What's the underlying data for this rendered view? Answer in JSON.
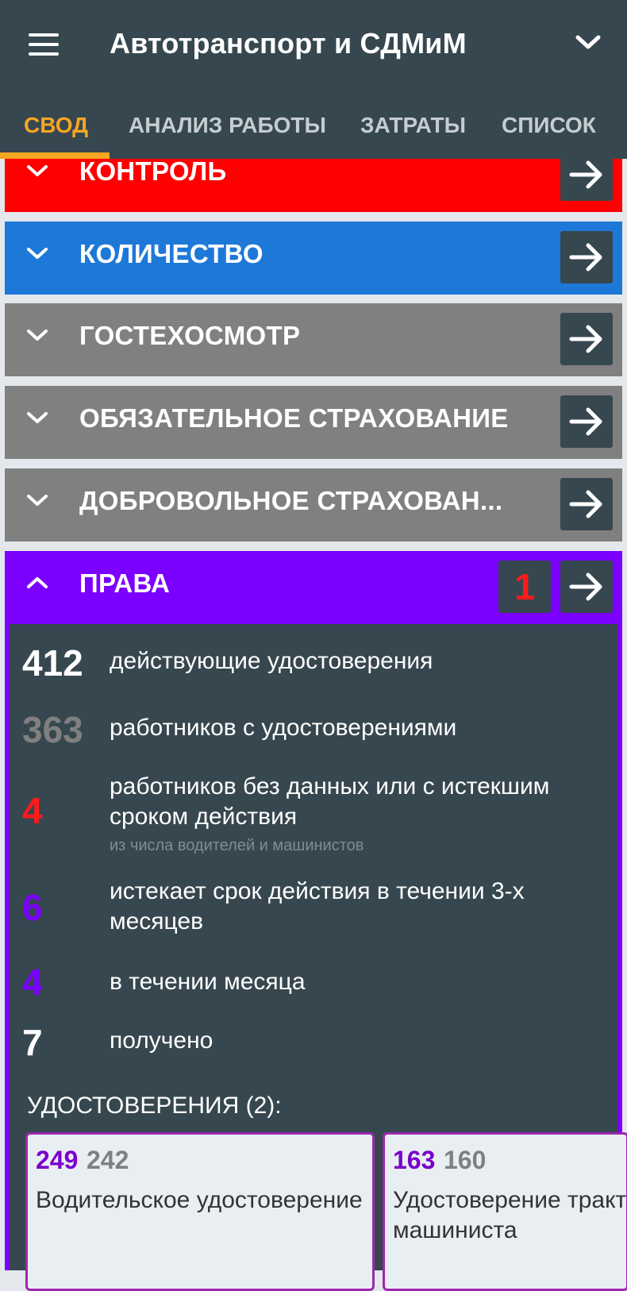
{
  "app": {
    "title": "Автотранспорт и СДМиМ",
    "icons": {
      "menu": "hamburger-menu-icon",
      "dropdown": "chevron-down-icon"
    }
  },
  "tabs": [
    {
      "label": "СВОД",
      "active": true
    },
    {
      "label": "АНАЛИЗ РАБОТЫ",
      "active": false
    },
    {
      "label": "ЗАТРАТЫ",
      "active": false
    },
    {
      "label": "СПИСОК",
      "active": false
    }
  ],
  "sections": [
    {
      "label": "КОНТРОЛЬ",
      "color": "#ff0000",
      "expanded": false
    },
    {
      "label": "КОЛИЧЕСТВО",
      "color": "#1e78d8",
      "expanded": false
    },
    {
      "label": "ГОСТЕХОСМОТР",
      "color": "#808080",
      "expanded": false
    },
    {
      "label": "ОБЯЗАТЕЛЬНОЕ СТРАХОВАНИЕ",
      "color": "#808080",
      "expanded": false
    },
    {
      "label": "ДОБРОВОЛЬНОЕ СТРАХОВАН...",
      "color": "#808080",
      "expanded": false
    },
    {
      "label": "ПРАВА",
      "color": "#7b00ff",
      "expanded": true,
      "badge": "1"
    }
  ],
  "licenses": {
    "stats": [
      {
        "value": "412",
        "text": "действующие удостоверения",
        "color": "#ffffff"
      },
      {
        "value": "363",
        "text": "работников с удостоверениями",
        "color": "#808080"
      },
      {
        "value": "4",
        "text": "работников без данных или с истекшим сроком действия",
        "note": "из числа водителей и машинистов",
        "color": "#ff1a1a"
      },
      {
        "value": "6",
        "text": "истекает срок действия в течении 3-х месяцев",
        "color": "#7b00ff"
      },
      {
        "value": "4",
        "text": "в течении месяца",
        "color": "#7b00ff"
      },
      {
        "value": "7",
        "text": "получено",
        "color": "#ffffff"
      }
    ],
    "certs_heading": "УДОСТОВЕРЕНИЯ (2):",
    "cards": [
      {
        "count_total": "249",
        "count_workers": "242",
        "name": "Водительское удостоверение"
      },
      {
        "count_total": "163",
        "count_workers": "160",
        "name": "Удостоверение тракториста-машиниста"
      }
    ]
  },
  "colors": {
    "appbar": "#37474f",
    "accent": "#f5a623",
    "panel": "#37474f"
  }
}
